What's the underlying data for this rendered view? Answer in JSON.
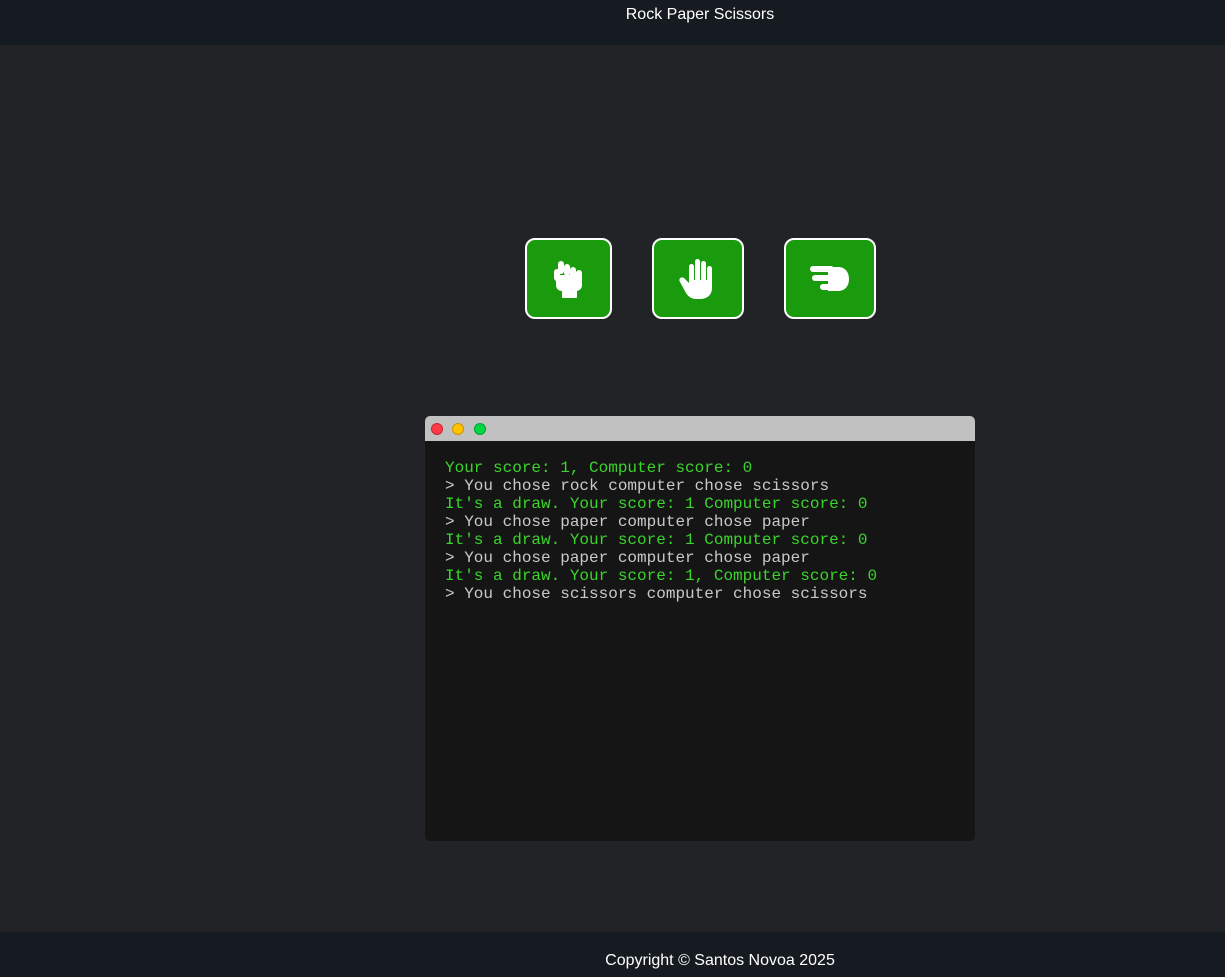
{
  "header": {
    "title": "Rock Paper Scissors"
  },
  "choices": [
    {
      "id": "rock",
      "icon": "hand-rock-icon"
    },
    {
      "id": "paper",
      "icon": "hand-paper-icon"
    },
    {
      "id": "scissors",
      "icon": "hand-scissors-icon"
    }
  ],
  "colors": {
    "button_bg": "#1a9a0d",
    "result_text": "#3bd42c",
    "command_text": "#c9c9c9",
    "terminal_bg": "#151515"
  },
  "terminal": {
    "lines": [
      {
        "type": "result",
        "text": "Your score: 1, Computer score: 0"
      },
      {
        "type": "cmd",
        "text": "> You chose rock computer chose scissors"
      },
      {
        "type": "result",
        "text": "It's a draw. Your score: 1 Computer score: 0"
      },
      {
        "type": "cmd",
        "text": "> You chose paper computer chose paper"
      },
      {
        "type": "result",
        "text": "It's a draw. Your score: 1 Computer score: 0"
      },
      {
        "type": "cmd",
        "text": "> You chose paper computer chose paper"
      },
      {
        "type": "result",
        "text": "It's a draw. Your score: 1, Computer score: 0"
      },
      {
        "type": "cmd",
        "text": "> You chose scissors computer chose scissors"
      }
    ]
  },
  "footer": {
    "copyright": "Copyright © Santos Novoa 2025"
  }
}
